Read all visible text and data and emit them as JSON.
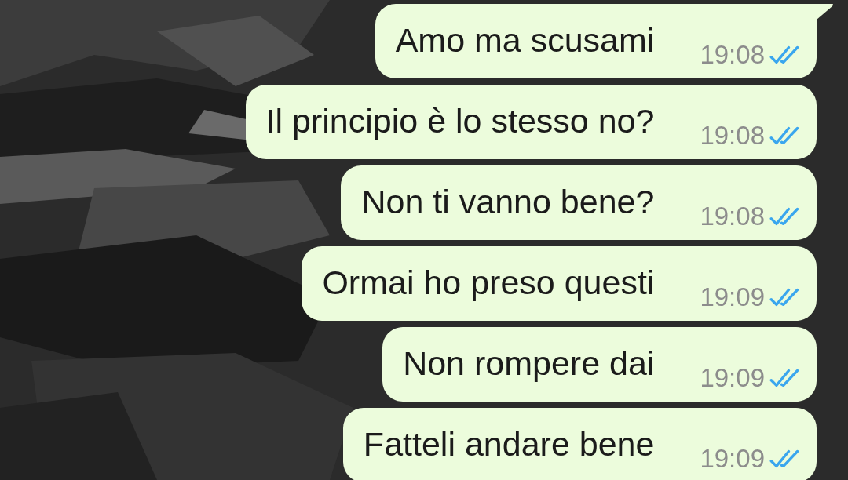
{
  "messages": [
    {
      "text": "Amo ma scusami",
      "time": "19:08",
      "read": true,
      "tail": true
    },
    {
      "text": "Il principio è lo stesso no?",
      "time": "19:08",
      "read": true,
      "tail": false
    },
    {
      "text": "Non ti vanno bene?",
      "time": "19:08",
      "read": true,
      "tail": false
    },
    {
      "text": "Ormai ho preso questi",
      "time": "19:09",
      "read": true,
      "tail": false
    },
    {
      "text": "Non rompere dai",
      "time": "19:09",
      "read": true,
      "tail": false
    },
    {
      "text": "Fatteli andare bene",
      "time": "19:09",
      "read": true,
      "tail": false
    }
  ]
}
